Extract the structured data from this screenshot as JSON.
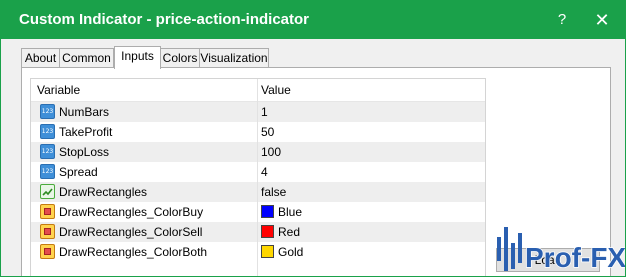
{
  "window": {
    "title": "Custom Indicator - price-action-indicator",
    "help_symbol": "?",
    "close_symbol": "✕",
    "accent_color": "#1aa14a"
  },
  "tabs": [
    {
      "label": "About",
      "active": false
    },
    {
      "label": "Common",
      "active": false
    },
    {
      "label": "Inputs",
      "active": true
    },
    {
      "label": "Colors",
      "active": false
    },
    {
      "label": "Visualization",
      "active": false
    }
  ],
  "table": {
    "headers": {
      "variable": "Variable",
      "value": "Value"
    },
    "rows": [
      {
        "icon": "numeric-icon",
        "variable": "NumBars",
        "value": "1"
      },
      {
        "icon": "numeric-icon",
        "variable": "TakeProfit",
        "value": "50"
      },
      {
        "icon": "numeric-icon",
        "variable": "StopLoss",
        "value": "100"
      },
      {
        "icon": "numeric-icon",
        "variable": "Spread",
        "value": "4"
      },
      {
        "icon": "boolean-icon",
        "variable": "DrawRectangles",
        "value": "false"
      },
      {
        "icon": "color-icon",
        "variable": "DrawRectangles_ColorBuy",
        "value": "Blue",
        "swatch": "#0000ff"
      },
      {
        "icon": "color-icon",
        "variable": "DrawRectangles_ColorSell",
        "value": "Red",
        "swatch": "#ff0000"
      },
      {
        "icon": "color-icon",
        "variable": "DrawRectangles_ColorBoth",
        "value": "Gold",
        "swatch": "#ffd700"
      }
    ]
  },
  "numeric_icon_text": "123",
  "side_button": {
    "label": "Load"
  },
  "watermark": {
    "text": "Prof-FX",
    "color": "#2a5fb0"
  }
}
